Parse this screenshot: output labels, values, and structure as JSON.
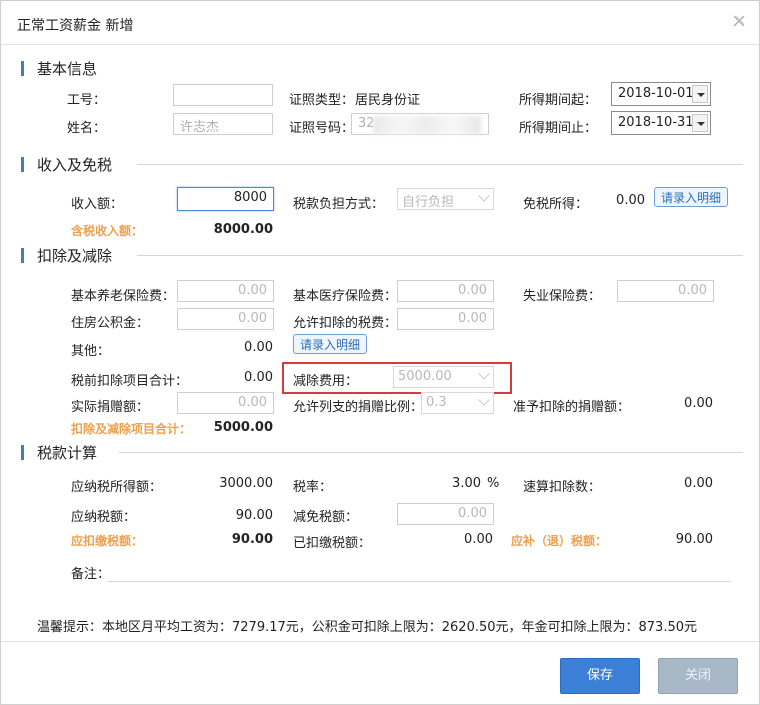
{
  "title": "正常工资薪金 新增",
  "sections": {
    "basic": "基本信息",
    "income": "收入及免税",
    "deduct": "扣除及减除",
    "tax": "税款计算"
  },
  "basic": {
    "emp_no_label": "工号：",
    "emp_no_value": "",
    "name_label": "姓名：",
    "name_value": "许志杰",
    "id_type_label": "证照类型：",
    "id_type_value": "居民身份证",
    "id_no_label": "证照号码：",
    "id_no_value": "32",
    "period_start_label": "所得期间起：",
    "period_start_value": "2018-10-01",
    "period_end_label": "所得期间止：",
    "period_end_value": "2018-10-31"
  },
  "income": {
    "income_label": "收入额：",
    "income_value": "8000",
    "tax_bearer_label": "税款负担方式：",
    "tax_bearer_value": "自行负担",
    "exempt_label": "免税所得：",
    "exempt_value": "0.00",
    "detail_button": "请录入明细",
    "taxable_income_label": "含税收入额：",
    "taxable_income_value": "8000.00"
  },
  "deduct": {
    "pension_label": "基本养老保险费：",
    "pension_value": "0.00",
    "medical_label": "基本医疗保险费：",
    "medical_value": "0.00",
    "unemployment_label": "失业保险费：",
    "unemployment_value": "0.00",
    "housing_label": "住房公积金：",
    "housing_value": "0.00",
    "allowed_tax_label": "允许扣除的税费：",
    "allowed_tax_value": "0.00",
    "other_label": "其他：",
    "other_value": "0.00",
    "detail_button": "请录入明细",
    "pretax_total_label": "税前扣除项目合计：",
    "pretax_total_value": "0.00",
    "reduction_label": "减除费用：",
    "reduction_value": "5000.00",
    "donation_label": "实际捐赠额：",
    "donation_value": "0.00",
    "donation_ratio_label": "允许列支的捐赠比例：",
    "donation_ratio_value": "0.3",
    "allowed_donation_label": "准予扣除的捐赠额：",
    "allowed_donation_value": "0.00",
    "deduct_total_label": "扣除及减除项目合计：",
    "deduct_total_value": "5000.00"
  },
  "tax": {
    "taxable_label": "应纳税所得额：",
    "taxable_value": "3000.00",
    "rate_label": "税率：",
    "rate_value": "3.00",
    "rate_unit": "%",
    "quick_label": "速算扣除数：",
    "quick_value": "0.00",
    "payable_label": "应纳税额：",
    "payable_value": "90.00",
    "relief_label": "减免税额：",
    "relief_value": "0.00",
    "withhold_label": "应扣缴税额：",
    "withhold_value": "90.00",
    "paid_label": "已扣缴税额：",
    "paid_value": "0.00",
    "refund_label": "应补（退）税额：",
    "refund_value": "90.00",
    "remark_label": "备注："
  },
  "tip": "温馨提示：本地区月平均工资为：7279.17元，公积金可扣除上限为：2620.50元，年金可扣除上限为：873.50元",
  "buttons": {
    "save": "保存",
    "close": "关闭"
  },
  "colors": {
    "accent": "#3c7fd6",
    "highlight_box": "#d63b3b",
    "orange_label": "#f0a04b"
  }
}
